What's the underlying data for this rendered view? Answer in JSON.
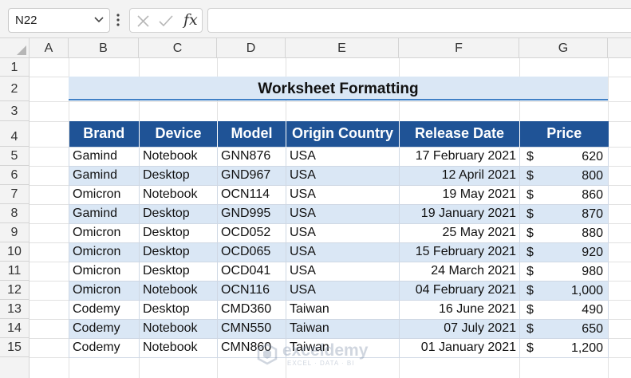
{
  "name_box": {
    "value": "N22"
  },
  "formula_bar": {
    "fx_label": "fx",
    "value": ""
  },
  "columns": [
    "A",
    "B",
    "C",
    "D",
    "E",
    "F",
    "G"
  ],
  "rows": [
    "1",
    "2",
    "3",
    "4",
    "5",
    "6",
    "7",
    "8",
    "9",
    "10",
    "11",
    "12",
    "13",
    "14",
    "15"
  ],
  "sheet": {
    "title": "Worksheet Formatting",
    "headers": [
      "Brand",
      "Device",
      "Model",
      "Origin Country",
      "Release Date",
      "Price"
    ],
    "records": [
      {
        "brand": "Gamind",
        "device": "Notebook",
        "model": "GNN876",
        "country": "USA",
        "date": "17 February 2021",
        "currency": "$",
        "price": "620"
      },
      {
        "brand": "Gamind",
        "device": "Desktop",
        "model": "GND967",
        "country": "USA",
        "date": "12 April 2021",
        "currency": "$",
        "price": "800"
      },
      {
        "brand": "Omicron",
        "device": "Notebook",
        "model": "OCN114",
        "country": "USA",
        "date": "19 May 2021",
        "currency": "$",
        "price": "860"
      },
      {
        "brand": "Gamind",
        "device": "Desktop",
        "model": "GND995",
        "country": "USA",
        "date": "19 January 2021",
        "currency": "$",
        "price": "870"
      },
      {
        "brand": "Omicron",
        "device": "Desktop",
        "model": "OCD052",
        "country": "USA",
        "date": "25 May 2021",
        "currency": "$",
        "price": "880"
      },
      {
        "brand": "Omicron",
        "device": "Desktop",
        "model": "OCD065",
        "country": "USA",
        "date": "15 February 2021",
        "currency": "$",
        "price": "920"
      },
      {
        "brand": "Omicron",
        "device": "Desktop",
        "model": "OCD041",
        "country": "USA",
        "date": "24 March 2021",
        "currency": "$",
        "price": "980"
      },
      {
        "brand": "Omicron",
        "device": "Notebook",
        "model": "OCN116",
        "country": "USA",
        "date": "04 February 2021",
        "currency": "$",
        "price": "1,000"
      },
      {
        "brand": "Codemy",
        "device": "Desktop",
        "model": "CMD360",
        "country": "Taiwan",
        "date": "16 June 2021",
        "currency": "$",
        "price": "490"
      },
      {
        "brand": "Codemy",
        "device": "Notebook",
        "model": "CMN550",
        "country": "Taiwan",
        "date": "07 July 2021",
        "currency": "$",
        "price": "650"
      },
      {
        "brand": "Codemy",
        "device": "Notebook",
        "model": "CMN860",
        "country": "Taiwan",
        "date": "01 January 2021",
        "currency": "$",
        "price": "1,200"
      }
    ]
  },
  "watermark": {
    "name": "exceldemy",
    "tagline": "EXCEL · DATA · BI"
  },
  "colors": {
    "header_fill": "#1f5396",
    "band_fill": "#dae7f5",
    "title_rule": "#3f80c6"
  }
}
